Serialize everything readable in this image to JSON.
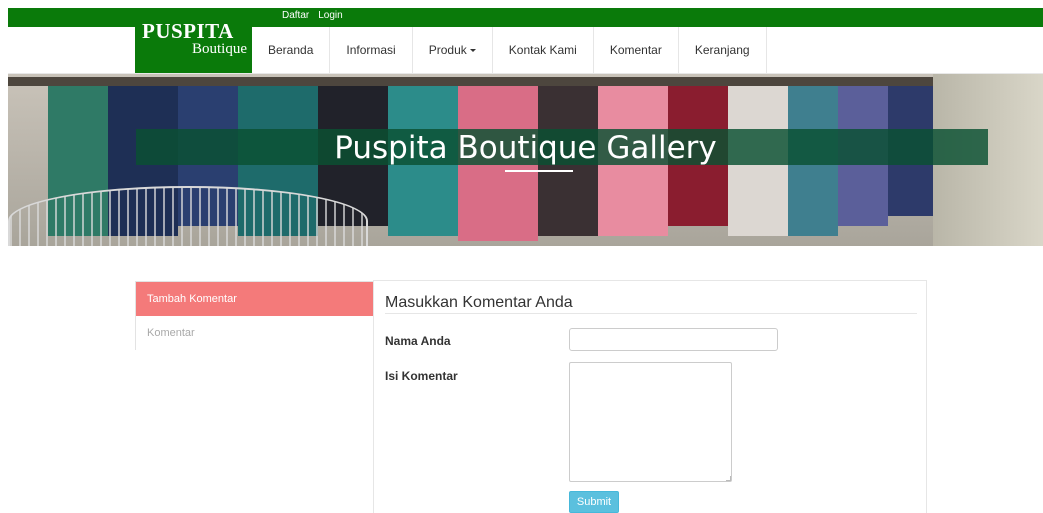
{
  "header": {
    "top_links": [
      "Daftar",
      "Login"
    ],
    "brand_main": "PUSPITA",
    "brand_sub": "Boutique",
    "nav": [
      {
        "label": "Beranda"
      },
      {
        "label": "Informasi"
      },
      {
        "label": "Produk"
      },
      {
        "label": "Kontak Kami"
      },
      {
        "label": "Komentar"
      },
      {
        "label": "Keranjang"
      }
    ],
    "accent_color": "#0a7a0a"
  },
  "hero": {
    "title": "Puspita Boutique Gallery"
  },
  "sidebar": {
    "items": [
      {
        "label": "Tambah Komentar",
        "active": true
      },
      {
        "label": "Komentar",
        "active": false
      }
    ],
    "active_color": "#f47a7a"
  },
  "form": {
    "title": "Masukkan Komentar Anda",
    "name_label": "Nama Anda",
    "name_value": "",
    "comment_label": "Isi Komentar",
    "comment_value": "",
    "submit_label": "Submit",
    "submit_color": "#5bc0de"
  }
}
